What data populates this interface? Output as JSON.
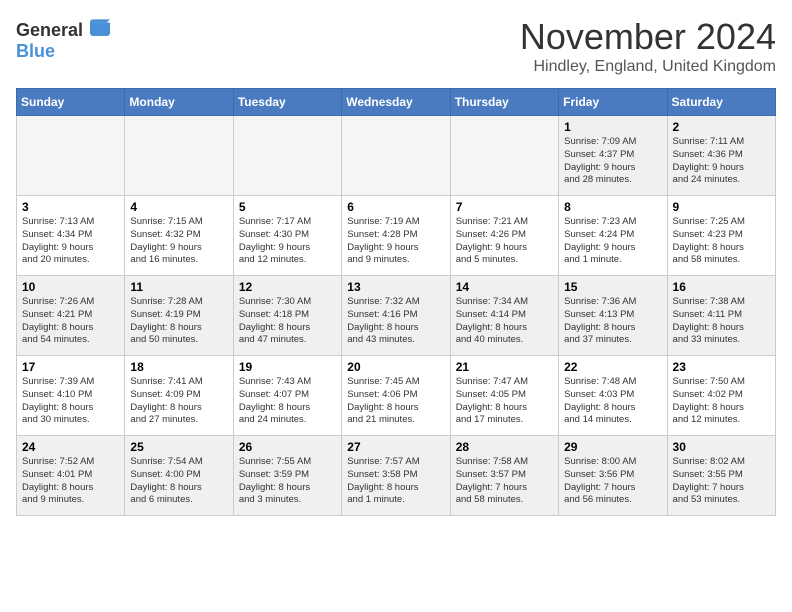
{
  "logo": {
    "general": "General",
    "blue": "Blue"
  },
  "title": "November 2024",
  "location": "Hindley, England, United Kingdom",
  "days_of_week": [
    "Sunday",
    "Monday",
    "Tuesday",
    "Wednesday",
    "Thursday",
    "Friday",
    "Saturday"
  ],
  "weeks": [
    [
      {
        "day": "",
        "info": ""
      },
      {
        "day": "",
        "info": ""
      },
      {
        "day": "",
        "info": ""
      },
      {
        "day": "",
        "info": ""
      },
      {
        "day": "",
        "info": ""
      },
      {
        "day": "1",
        "info": "Sunrise: 7:09 AM\nSunset: 4:37 PM\nDaylight: 9 hours\nand 28 minutes."
      },
      {
        "day": "2",
        "info": "Sunrise: 7:11 AM\nSunset: 4:36 PM\nDaylight: 9 hours\nand 24 minutes."
      }
    ],
    [
      {
        "day": "3",
        "info": "Sunrise: 7:13 AM\nSunset: 4:34 PM\nDaylight: 9 hours\nand 20 minutes."
      },
      {
        "day": "4",
        "info": "Sunrise: 7:15 AM\nSunset: 4:32 PM\nDaylight: 9 hours\nand 16 minutes."
      },
      {
        "day": "5",
        "info": "Sunrise: 7:17 AM\nSunset: 4:30 PM\nDaylight: 9 hours\nand 12 minutes."
      },
      {
        "day": "6",
        "info": "Sunrise: 7:19 AM\nSunset: 4:28 PM\nDaylight: 9 hours\nand 9 minutes."
      },
      {
        "day": "7",
        "info": "Sunrise: 7:21 AM\nSunset: 4:26 PM\nDaylight: 9 hours\nand 5 minutes."
      },
      {
        "day": "8",
        "info": "Sunrise: 7:23 AM\nSunset: 4:24 PM\nDaylight: 9 hours\nand 1 minute."
      },
      {
        "day": "9",
        "info": "Sunrise: 7:25 AM\nSunset: 4:23 PM\nDaylight: 8 hours\nand 58 minutes."
      }
    ],
    [
      {
        "day": "10",
        "info": "Sunrise: 7:26 AM\nSunset: 4:21 PM\nDaylight: 8 hours\nand 54 minutes."
      },
      {
        "day": "11",
        "info": "Sunrise: 7:28 AM\nSunset: 4:19 PM\nDaylight: 8 hours\nand 50 minutes."
      },
      {
        "day": "12",
        "info": "Sunrise: 7:30 AM\nSunset: 4:18 PM\nDaylight: 8 hours\nand 47 minutes."
      },
      {
        "day": "13",
        "info": "Sunrise: 7:32 AM\nSunset: 4:16 PM\nDaylight: 8 hours\nand 43 minutes."
      },
      {
        "day": "14",
        "info": "Sunrise: 7:34 AM\nSunset: 4:14 PM\nDaylight: 8 hours\nand 40 minutes."
      },
      {
        "day": "15",
        "info": "Sunrise: 7:36 AM\nSunset: 4:13 PM\nDaylight: 8 hours\nand 37 minutes."
      },
      {
        "day": "16",
        "info": "Sunrise: 7:38 AM\nSunset: 4:11 PM\nDaylight: 8 hours\nand 33 minutes."
      }
    ],
    [
      {
        "day": "17",
        "info": "Sunrise: 7:39 AM\nSunset: 4:10 PM\nDaylight: 8 hours\nand 30 minutes."
      },
      {
        "day": "18",
        "info": "Sunrise: 7:41 AM\nSunset: 4:09 PM\nDaylight: 8 hours\nand 27 minutes."
      },
      {
        "day": "19",
        "info": "Sunrise: 7:43 AM\nSunset: 4:07 PM\nDaylight: 8 hours\nand 24 minutes."
      },
      {
        "day": "20",
        "info": "Sunrise: 7:45 AM\nSunset: 4:06 PM\nDaylight: 8 hours\nand 21 minutes."
      },
      {
        "day": "21",
        "info": "Sunrise: 7:47 AM\nSunset: 4:05 PM\nDaylight: 8 hours\nand 17 minutes."
      },
      {
        "day": "22",
        "info": "Sunrise: 7:48 AM\nSunset: 4:03 PM\nDaylight: 8 hours\nand 14 minutes."
      },
      {
        "day": "23",
        "info": "Sunrise: 7:50 AM\nSunset: 4:02 PM\nDaylight: 8 hours\nand 12 minutes."
      }
    ],
    [
      {
        "day": "24",
        "info": "Sunrise: 7:52 AM\nSunset: 4:01 PM\nDaylight: 8 hours\nand 9 minutes."
      },
      {
        "day": "25",
        "info": "Sunrise: 7:54 AM\nSunset: 4:00 PM\nDaylight: 8 hours\nand 6 minutes."
      },
      {
        "day": "26",
        "info": "Sunrise: 7:55 AM\nSunset: 3:59 PM\nDaylight: 8 hours\nand 3 minutes."
      },
      {
        "day": "27",
        "info": "Sunrise: 7:57 AM\nSunset: 3:58 PM\nDaylight: 8 hours\nand 1 minute."
      },
      {
        "day": "28",
        "info": "Sunrise: 7:58 AM\nSunset: 3:57 PM\nDaylight: 7 hours\nand 58 minutes."
      },
      {
        "day": "29",
        "info": "Sunrise: 8:00 AM\nSunset: 3:56 PM\nDaylight: 7 hours\nand 56 minutes."
      },
      {
        "day": "30",
        "info": "Sunrise: 8:02 AM\nSunset: 3:55 PM\nDaylight: 7 hours\nand 53 minutes."
      }
    ]
  ]
}
